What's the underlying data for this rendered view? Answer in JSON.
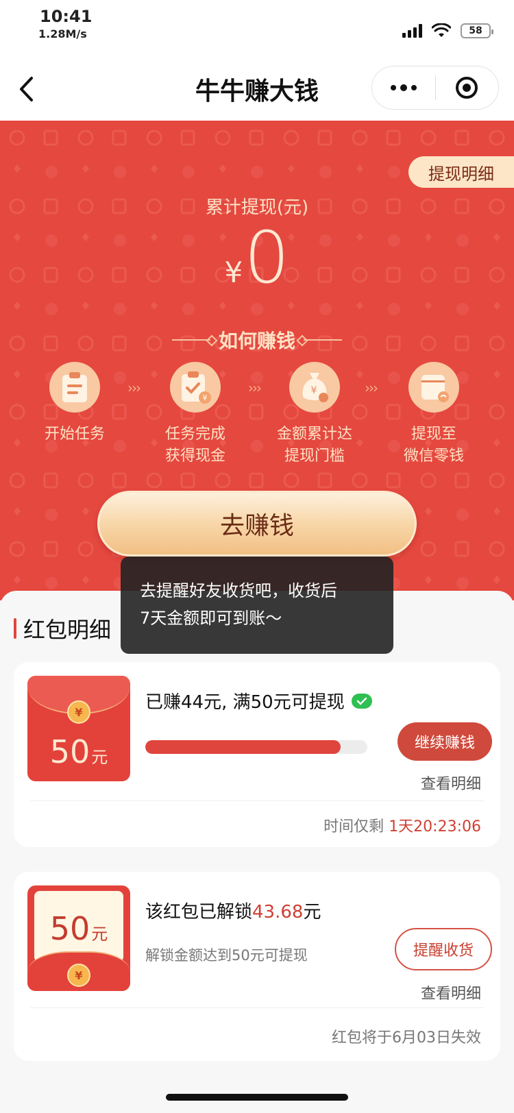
{
  "status_bar": {
    "time": "10:41",
    "speed": "1.28M/s",
    "battery": "58"
  },
  "nav": {
    "title": "牛牛赚大钱"
  },
  "hero": {
    "withdraw_detail_label": "提现明细",
    "total_label": "累计提现(元)",
    "currency_symbol": "¥",
    "total_amount": "0",
    "how_title": "如何赚钱",
    "steps": [
      {
        "line1": "开始任务",
        "line2": "",
        "icon": "clipboard-icon"
      },
      {
        "line1": "任务完成",
        "line2": "获得现金",
        "icon": "clipboard-check-icon"
      },
      {
        "line1": "金额累计达",
        "line2": "提现门槛",
        "icon": "money-bag-icon"
      },
      {
        "line1": "提现至",
        "line2": "微信零钱",
        "icon": "wallet-icon"
      }
    ],
    "step_arrow": "›››",
    "earn_button": "去赚钱"
  },
  "toast": {
    "line1": "去提醒好友收货吧，收货后",
    "line2": "7天金额即可到账～"
  },
  "section": {
    "title": "红包明细"
  },
  "cards": [
    {
      "envelope_amount": "50",
      "envelope_unit": "元",
      "coin_symbol": "¥",
      "headline": "已赚44元, 满50元可提现",
      "progress_earned": 44,
      "progress_target": 50,
      "action_label": "继续赚钱",
      "view_label": "查看明细",
      "footer_prefix": "时间仅剩",
      "footer_countdown": "1天20:23:06"
    },
    {
      "envelope_amount": "50",
      "envelope_unit": "元",
      "coin_symbol": "¥",
      "headline_prefix": "该红包已解锁",
      "headline_value": "43.68",
      "headline_suffix": "元",
      "sub_text": "解锁金额达到50元可提现",
      "action_label": "提醒收货",
      "view_label": "查看明细",
      "footer_text": "红包将于6月03日失效"
    }
  ],
  "colors": {
    "hero_red": "#e5483f",
    "accent_red": "#e0453d",
    "gold": "#f8d7a9",
    "check_green": "#2fbf52"
  }
}
